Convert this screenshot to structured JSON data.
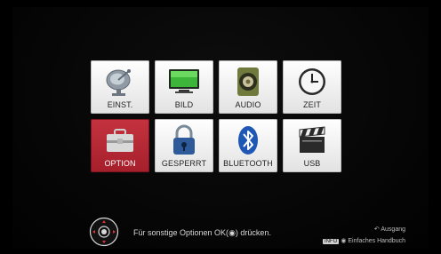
{
  "menu": {
    "tiles": [
      {
        "label": "EINST.",
        "icon": "satellite-dish-icon"
      },
      {
        "label": "BILD",
        "icon": "tv-screen-icon"
      },
      {
        "label": "AUDIO",
        "icon": "speaker-icon"
      },
      {
        "label": "ZEIT",
        "icon": "clock-icon"
      },
      {
        "label": "OPTION",
        "icon": "toolbox-icon",
        "selected": true
      },
      {
        "label": "GESPERRT",
        "icon": "padlock-icon"
      },
      {
        "label": "BLUETOOTH",
        "icon": "bluetooth-icon"
      },
      {
        "label": "USB",
        "icon": "clapperboard-icon"
      }
    ]
  },
  "footer": {
    "hint_prefix": "Für sonstige Optionen OK(",
    "hint_suffix": ") drücken.",
    "exit_label": "Ausgang",
    "info_badge": "INFO",
    "manual_label": "Einfaches Handbuch"
  },
  "colors": {
    "selected_tile": "#b72a35",
    "tile_bg": "#f2f2f2"
  }
}
